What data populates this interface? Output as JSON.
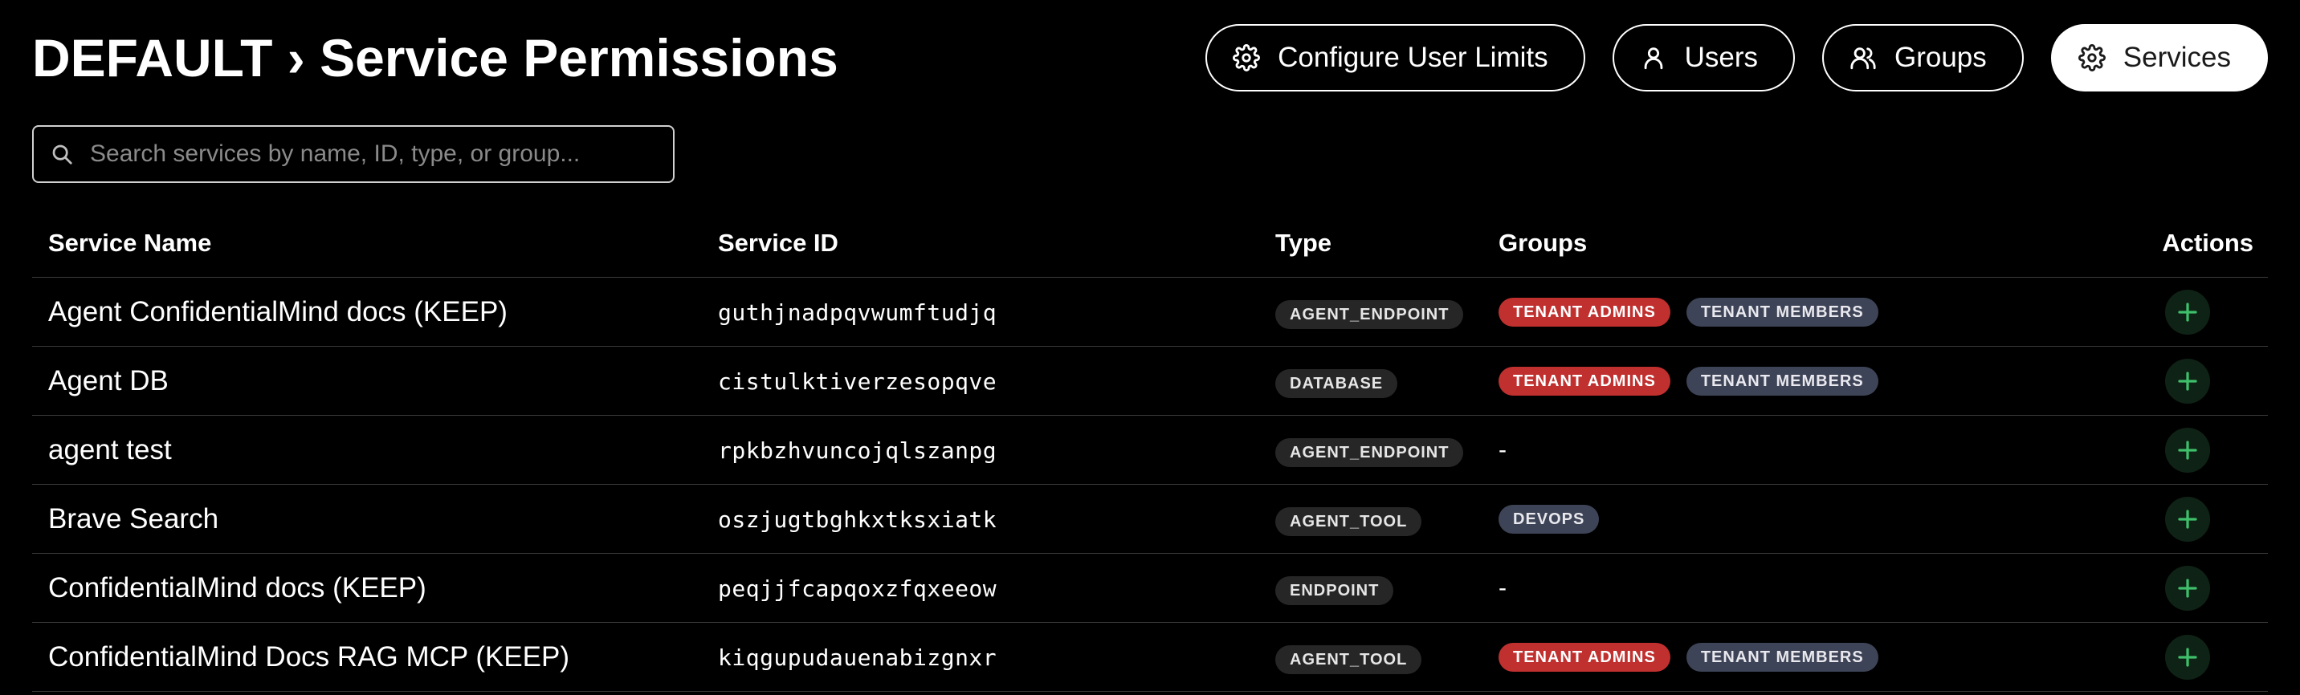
{
  "header": {
    "title": "DEFAULT › Service Permissions"
  },
  "nav": [
    {
      "label": "Configure User Limits",
      "icon": "gear-icon",
      "active": false
    },
    {
      "label": "Users",
      "icon": "user-icon",
      "active": false
    },
    {
      "label": "Groups",
      "icon": "users-icon",
      "active": false
    },
    {
      "label": "Services",
      "icon": "gear-icon",
      "active": true
    }
  ],
  "search": {
    "placeholder": "Search services by name, ID, type, or group...",
    "value": ""
  },
  "table": {
    "columns": {
      "name": "Service Name",
      "id": "Service ID",
      "type": "Type",
      "groups": "Groups",
      "actions": "Actions"
    },
    "rows": [
      {
        "name": "Agent ConfidentialMind docs (KEEP)",
        "id": "guthjnadpqvwumftudjq",
        "type": "AGENT_ENDPOINT",
        "groups": [
          "TENANT ADMINS",
          "TENANT MEMBERS"
        ],
        "groups_empty": ""
      },
      {
        "name": "Agent DB",
        "id": "cistulktiverzesopqve",
        "type": "DATABASE",
        "groups": [
          "TENANT ADMINS",
          "TENANT MEMBERS"
        ],
        "groups_empty": ""
      },
      {
        "name": "agent test",
        "id": "rpkbzhvuncojqlszanpg",
        "type": "AGENT_ENDPOINT",
        "groups": [],
        "groups_empty": "-"
      },
      {
        "name": "Brave Search",
        "id": "oszjugtbghkxtksxiatk",
        "type": "AGENT_TOOL",
        "groups": [
          "DEVOPS"
        ],
        "groups_empty": ""
      },
      {
        "name": "ConfidentialMind docs (KEEP)",
        "id": "peqjjfcapqoxzfqxeeow",
        "type": "ENDPOINT",
        "groups": [],
        "groups_empty": "-"
      },
      {
        "name": "ConfidentialMind Docs RAG MCP (KEEP)",
        "id": "kiqgupudauenabizgnxr",
        "type": "AGENT_TOOL",
        "groups": [
          "TENANT ADMINS",
          "TENANT MEMBERS"
        ],
        "groups_empty": ""
      }
    ]
  },
  "colors": {
    "background": "#000000",
    "admin_badge": "#c0302f",
    "member_badge": "#3e4457",
    "add_icon": "#3fbf6a"
  }
}
